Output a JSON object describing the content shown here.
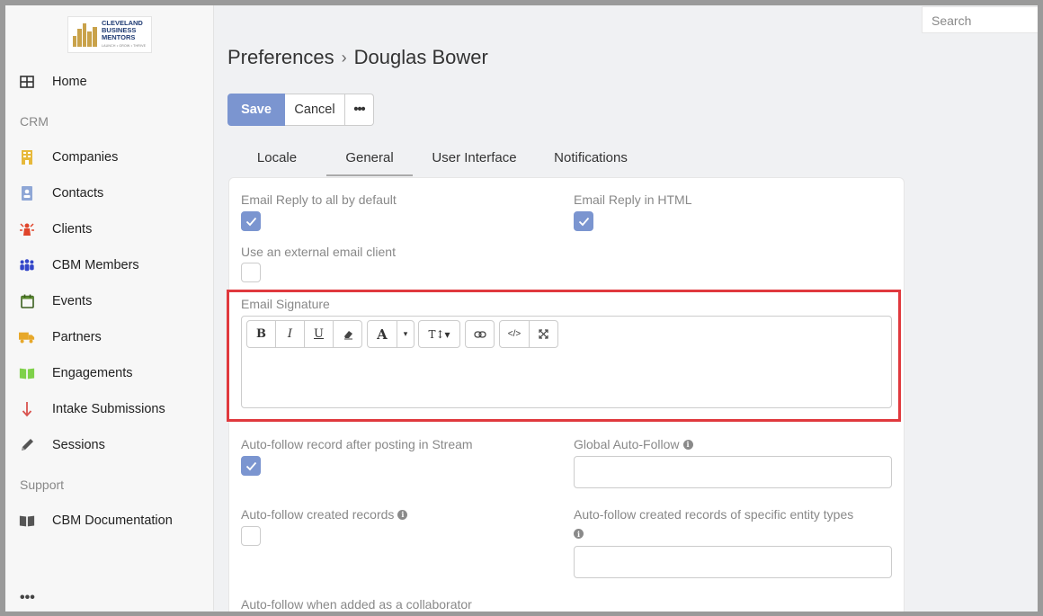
{
  "app": {
    "logo": {
      "line1": "CLEVELAND",
      "line2": "BUSINESS",
      "line3": "MENTORS",
      "tagline": "LAUNCH • GROW • THRIVE"
    }
  },
  "search": {
    "placeholder": "Search"
  },
  "sidebar": {
    "home": {
      "label": "Home",
      "icon": "home-grid-icon"
    },
    "group_crm": "CRM",
    "items": [
      {
        "label": "Companies",
        "icon": "building-icon",
        "color": "#e7b93b"
      },
      {
        "label": "Contacts",
        "icon": "contact-card-icon",
        "color": "#8fa7d6"
      },
      {
        "label": "Clients",
        "icon": "person-burst-icon",
        "color": "#e0452b"
      },
      {
        "label": "CBM Members",
        "icon": "group-icon",
        "color": "#3346c9"
      },
      {
        "label": "Events",
        "icon": "calendar-icon",
        "color": "#5a8a2e"
      },
      {
        "label": "Partners",
        "icon": "truck-icon",
        "color": "#e7a82a"
      },
      {
        "label": "Engagements",
        "icon": "book-open-icon",
        "color": "#7fd14a"
      },
      {
        "label": "Intake Submissions",
        "icon": "arrow-down-icon",
        "color": "#d9534f"
      },
      {
        "label": "Sessions",
        "icon": "pencil-icon",
        "color": "#555555"
      }
    ],
    "group_support": "Support",
    "support_items": [
      {
        "label": "CBM Documentation",
        "icon": "book-icon",
        "color": "#555555"
      }
    ],
    "more": "•••"
  },
  "header": {
    "breadcrumb_root": "Preferences",
    "breadcrumb_sep": "›",
    "breadcrumb_current": "Douglas Bower"
  },
  "actions": {
    "save": "Save",
    "cancel": "Cancel",
    "more": "•••"
  },
  "tabs": [
    {
      "label": "Locale",
      "active": false
    },
    {
      "label": "General",
      "active": true
    },
    {
      "label": "User Interface",
      "active": false
    },
    {
      "label": "Notifications",
      "active": false
    }
  ],
  "form": {
    "email_reply_all": {
      "label": "Email Reply to all by default",
      "checked": true
    },
    "email_reply_html": {
      "label": "Email Reply in HTML",
      "checked": true
    },
    "external_client": {
      "label": "Use an external email client",
      "checked": false
    },
    "email_signature": {
      "label": "Email Signature",
      "value": ""
    },
    "auto_follow_stream": {
      "label": "Auto-follow record after posting in Stream",
      "checked": true
    },
    "global_auto_follow": {
      "label": "Global Auto-Follow",
      "value": ""
    },
    "auto_follow_created": {
      "label": "Auto-follow created records",
      "checked": false
    },
    "auto_follow_entity_types": {
      "label": "Auto-follow created records of specific entity types",
      "value": ""
    },
    "auto_follow_collaborator": {
      "label": "Auto-follow when added as a collaborator"
    }
  },
  "editor_toolbar": {
    "bold": "B",
    "italic": "I",
    "underline": "U",
    "eraser": "eraser-icon",
    "font_color": "A",
    "caret": "▾",
    "font_size": "T↕▾",
    "link": "link-icon",
    "code": "</>",
    "fullscreen": "expand-icon"
  },
  "colors": {
    "accent": "#7b95d0",
    "highlight": "#e0393e"
  }
}
